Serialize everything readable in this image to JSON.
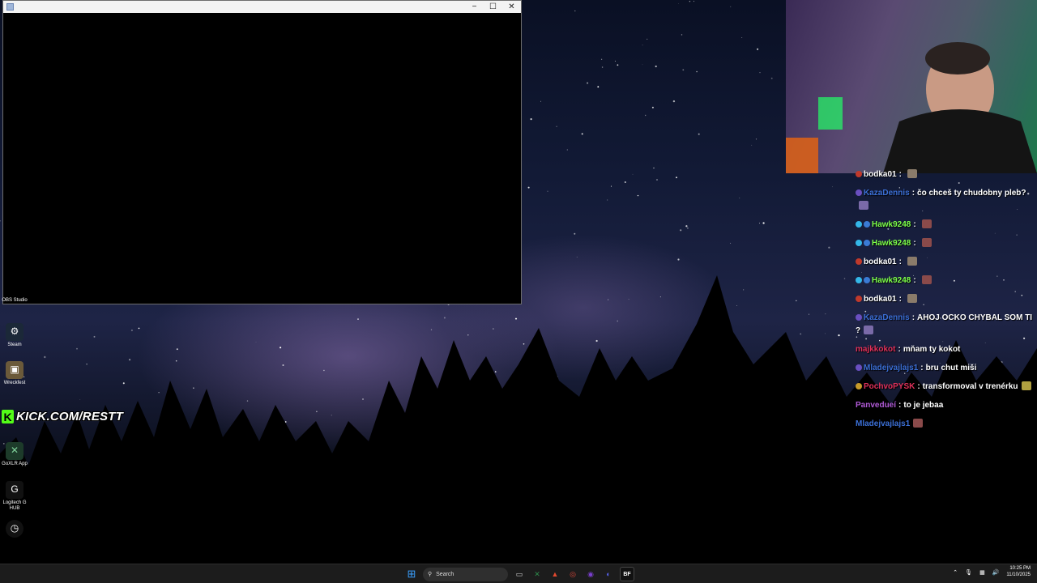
{
  "app_window": {
    "controls": {
      "minimize": "−",
      "maximize": "☐",
      "close": "✕"
    }
  },
  "desktop_icons": [
    {
      "label": "OBS Studio",
      "icon": "obs-icon",
      "color": "#2b2b2b"
    },
    {
      "label": "Steam",
      "icon": "steam-icon",
      "color": "#1b2838"
    },
    {
      "label": "Wreckfest",
      "icon": "wreckfest-icon",
      "color": "#6b5a3a"
    },
    {
      "label": "GoXLR App",
      "icon": "goxlr-icon",
      "color": "#1d3b2a"
    },
    {
      "label": "Logitech G HUB",
      "icon": "logitech-icon",
      "color": "#111111"
    }
  ],
  "kick_banner": {
    "text": "KICK.COM/RESTT",
    "logo": "K",
    "accent": "#53fc18"
  },
  "chat": [
    {
      "user": "bodka01",
      "sep": ":",
      "text": "",
      "color": "#ffffff",
      "badges": [
        "#c0392b"
      ],
      "emote": "#8a7b6a"
    },
    {
      "user": "KazaDennis",
      "sep": ":",
      "text": "čo chceš ty chudobny pleb?",
      "color": "#3b6fd6",
      "badges": [
        "#6a4fc0"
      ],
      "emote": "#7a6aa8"
    },
    {
      "user": "Hawk9248",
      "sep": ":",
      "text": "",
      "color": "#7dff4a",
      "badges": [
        "#34b7e8",
        "#3a7bd5"
      ],
      "emote": "#8a4a4a"
    },
    {
      "user": "Hawk9248",
      "sep": ":",
      "text": "",
      "color": "#7dff4a",
      "badges": [
        "#34b7e8",
        "#3a7bd5"
      ],
      "emote": "#8a4a4a"
    },
    {
      "user": "bodka01",
      "sep": ":",
      "text": "",
      "color": "#ffffff",
      "badges": [
        "#c0392b"
      ],
      "emote": "#8a7b6a"
    },
    {
      "user": "Hawk9248",
      "sep": ":",
      "text": "",
      "color": "#7dff4a",
      "badges": [
        "#34b7e8",
        "#3a7bd5"
      ],
      "emote": "#8a4a4a"
    },
    {
      "user": "bodka01",
      "sep": ":",
      "text": "",
      "color": "#ffffff",
      "badges": [
        "#c0392b"
      ],
      "emote": "#8a7b6a"
    },
    {
      "user": "KazaDennis",
      "sep": ":",
      "text": "AHOJ OCKO CHYBAL SOM TI ?",
      "color": "#3b6fd6",
      "badges": [
        "#6a4fc0"
      ],
      "emote": "#7a6aa8"
    },
    {
      "user": "majkkokot",
      "sep": ":",
      "text": "mňam ty kokot",
      "color": "#e0305a",
      "badges": [],
      "emote": ""
    },
    {
      "user": "Mladejvajlajs1",
      "sep": ":",
      "text": "bru chut miši",
      "color": "#3b6fd6",
      "badges": [
        "#6a4fc0"
      ],
      "emote": ""
    },
    {
      "user": "PochvoPYSK",
      "sep": ":",
      "text": "transformoval v trenérku",
      "color": "#e0305a",
      "badges": [
        "#c79a2a"
      ],
      "emote": "#b0a040"
    },
    {
      "user": "Panvedueí",
      "sep": ":",
      "text": "to je jebaa",
      "color": "#b05ad6",
      "badges": [],
      "emote": ""
    },
    {
      "user": "Mladejvajlajs1",
      "sep": "",
      "text": "",
      "color": "#3b6fd6",
      "badges": [],
      "emote": "#8a4a4a"
    }
  ],
  "taskbar": {
    "search_placeholder": "Search",
    "apps": [
      {
        "name": "start-icon",
        "glyph": "⊞",
        "color": "#3aa0ff"
      },
      {
        "name": "file-explorer-icon",
        "glyph": "▭",
        "color": "#d9d9d9"
      },
      {
        "name": "xbox-icon",
        "glyph": "✕",
        "color": "#2d8a4a"
      },
      {
        "name": "brave-icon",
        "glyph": "▲",
        "color": "#e2492f"
      },
      {
        "name": "chrome-icon",
        "glyph": "◎",
        "color": "#d8473a"
      },
      {
        "name": "obs-taskbar-icon",
        "glyph": "◉",
        "color": "#7b3fd0"
      },
      {
        "name": "discord-icon",
        "glyph": "◐",
        "color": "#5865f2"
      },
      {
        "name": "bf-icon",
        "glyph": "BF",
        "color": "#111111"
      }
    ],
    "time": "10:25 PM",
    "date": "11/10/2025"
  }
}
